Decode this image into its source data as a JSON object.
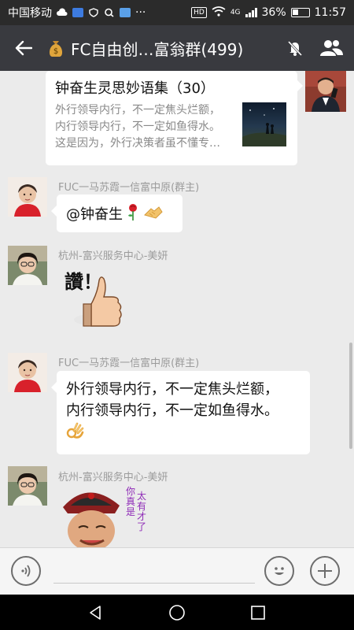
{
  "status_bar": {
    "carrier": "中国移动",
    "network": "4G",
    "battery": "36%",
    "time": "11:57",
    "hd_badge": "HD"
  },
  "header": {
    "title": "FC自由创…富翁群(499)"
  },
  "messages": {
    "card": {
      "title": "钟奋生灵思妙语集（30）",
      "desc_lines": [
        "外行领导内行，不一定焦头烂额，",
        "内行领导内行，不一定如鱼得水。",
        "这是因为，外行决策者虽不懂专…"
      ]
    },
    "msg1": {
      "sender": "FUC一马苏霞一信富中原(群主)",
      "text": "@钟奋生 "
    },
    "msg2": {
      "sender": "杭州-富兴服务中心-美妍",
      "sticker_text": "讚！"
    },
    "msg3": {
      "sender": "FUC一马苏霞一信富中原(群主)",
      "line1": "外行领导内行，不一定焦头烂额，",
      "line2": "内行领导内行，不一定如鱼得水。"
    },
    "msg4": {
      "sender": "杭州-富兴服务中心-美妍",
      "sticker_col1": "你真是",
      "sticker_col2": "太有才了"
    }
  },
  "colors": {
    "header_bg": "#393a3f",
    "chat_bg": "#ebebeb",
    "bubble_bg": "#ffffff",
    "sender_text": "#9b9b9b"
  }
}
